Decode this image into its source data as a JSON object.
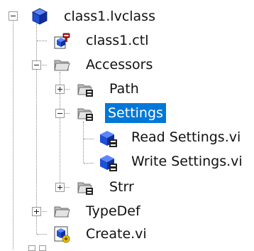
{
  "tree": {
    "root": {
      "label": "class1.lvclass",
      "icon": "lvclass-cube-icon",
      "expanded": true
    },
    "items": [
      {
        "label": "class1.ctl",
        "icon": "class-control-icon"
      },
      {
        "label": "Accessors",
        "icon": "folder-icon",
        "expanded": true
      },
      {
        "label": "Path",
        "icon": "virtual-folder-icon",
        "expanded": false
      },
      {
        "label": "Settings",
        "icon": "virtual-folder-icon",
        "expanded": true,
        "selected": true
      },
      {
        "label": "Read Settings.vi",
        "icon": "accessor-vi-icon"
      },
      {
        "label": "Write Settings.vi",
        "icon": "accessor-vi-icon"
      },
      {
        "label": "Strr",
        "icon": "virtual-folder-icon",
        "expanded": false
      },
      {
        "label": "TypeDef",
        "icon": "folder-icon",
        "expanded": false
      },
      {
        "label": "Create.vi",
        "icon": "vi-icon"
      }
    ]
  },
  "colors": {
    "selection": "#0078d7",
    "cube": "#1f4fd6",
    "folder": "#d9d9d9"
  }
}
